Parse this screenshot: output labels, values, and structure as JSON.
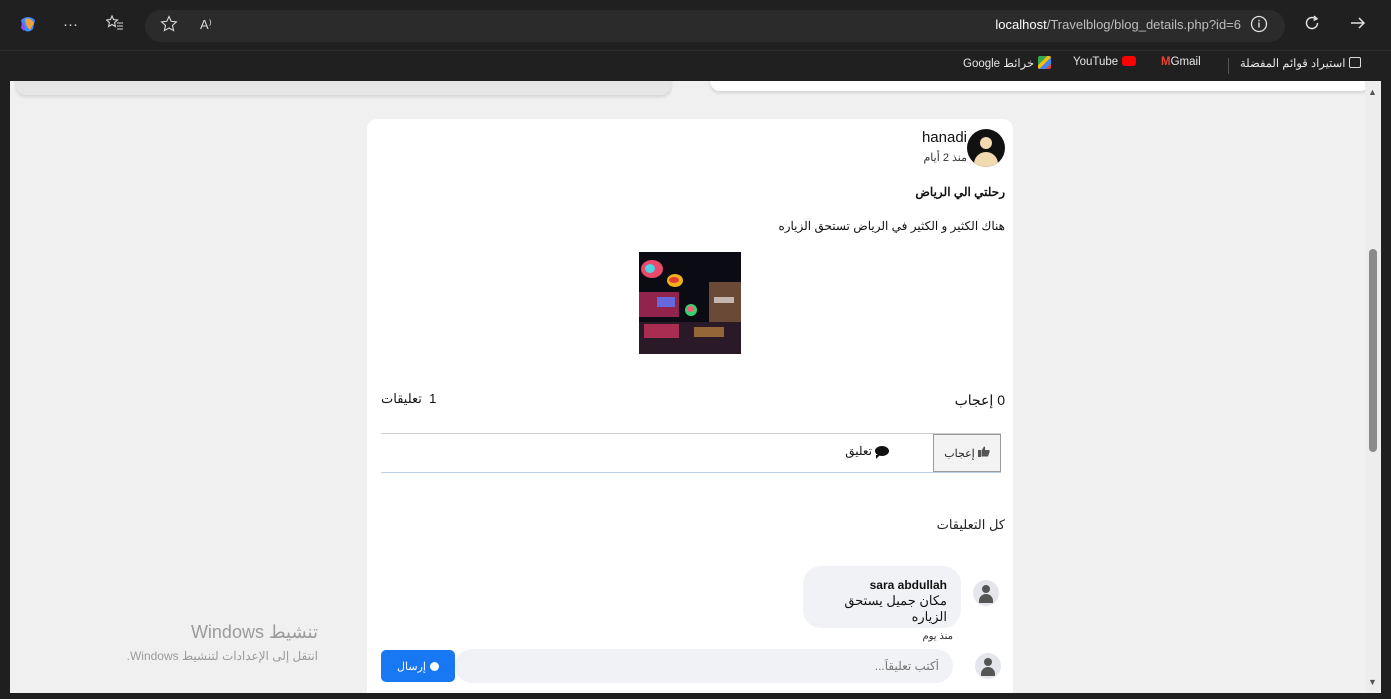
{
  "browser": {
    "url_host": "localhost",
    "url_path": "/Travelblog/blog_details.php?id=6",
    "icons": [
      "copilot-icon",
      "more-icon",
      "favorites-bar-icon",
      "star-icon",
      "read-aloud-icon",
      "info-icon",
      "refresh-icon",
      "forward-icon"
    ],
    "more_glyph": "···",
    "read_aloud_glyph": "A⁾",
    "bookmarks": [
      {
        "label": "استيراد قوائم المفضلة",
        "icon": "import-icon"
      },
      {
        "label": "Gmail",
        "icon": "gmail-icon"
      },
      {
        "label": "YouTube",
        "icon": "youtube-icon"
      },
      {
        "label": "خرائط Google",
        "icon": "maps-icon"
      }
    ]
  },
  "post": {
    "author": "hanadi",
    "time_ago": "منذ 2 أيام",
    "title": "رحلتي الي الرياض",
    "body": "هناك الكثير و الكثير في الرياض تستحق الزياره",
    "likes_count": "0",
    "likes_label": "إعجاب",
    "comments_count": "1",
    "comments_label": "تعليقات",
    "like_button": "إعجاب",
    "comment_button": "تعليق",
    "all_comments_heading": "كل التعليقات"
  },
  "comments": [
    {
      "name": "sara abdullah",
      "text": "مكان جميل يستحق الزياره",
      "time": "منذ يوم"
    }
  ],
  "reply": {
    "placeholder": "أكتب تعليقاً...",
    "send_label": "إرسال"
  },
  "watermark": {
    "title": "تنشيط Windows",
    "subtitle": "انتقل إلى الإعدادات لتنشيط Windows."
  },
  "colors": {
    "accent": "#1877f2",
    "page_bg": "#f0f0f0",
    "chrome_bg": "#202020"
  }
}
